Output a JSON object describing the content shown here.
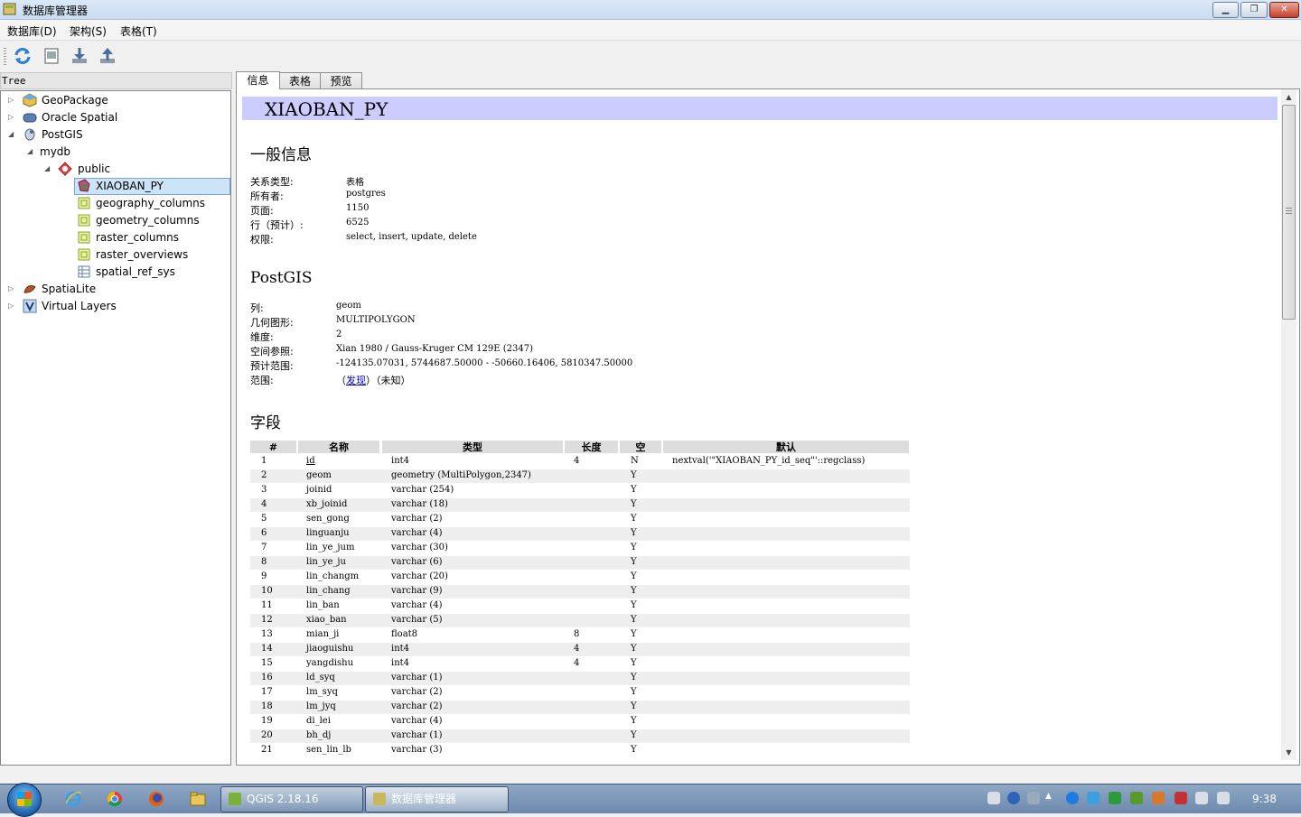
{
  "window": {
    "title": "数据库管理器"
  },
  "menu": {
    "database": "数据库(D)",
    "schema": "架构(S)",
    "table": "表格(T)"
  },
  "toolbar": {
    "buttons": [
      "refresh-icon",
      "sql-window-icon",
      "import-icon",
      "export-icon"
    ]
  },
  "tree": {
    "title": "Tree",
    "items": [
      {
        "label": "GeoPackage",
        "icon": "geopackage-icon"
      },
      {
        "label": "Oracle Spatial",
        "icon": "oracle-icon"
      },
      {
        "label": "PostGIS",
        "icon": "postgis-icon"
      },
      {
        "label": "mydb",
        "icon": ""
      },
      {
        "label": "public",
        "icon": "schema-icon"
      },
      {
        "label": "XIAOBAN_PY",
        "icon": "polygon-layer-icon"
      },
      {
        "label": "geography_columns",
        "icon": "table-icon"
      },
      {
        "label": "geometry_columns",
        "icon": "table-icon"
      },
      {
        "label": "raster_columns",
        "icon": "table-icon"
      },
      {
        "label": "raster_overviews",
        "icon": "table-icon"
      },
      {
        "label": "spatial_ref_sys",
        "icon": "table-grid-icon"
      },
      {
        "label": "SpatiaLite",
        "icon": "spatialite-icon"
      },
      {
        "label": "Virtual Layers",
        "icon": "virtual-layer-icon"
      }
    ]
  },
  "tabs": [
    "信息",
    "表格",
    "预览"
  ],
  "info": {
    "table_name": "XIAOBAN_PY",
    "general_heading": "一般信息",
    "general": [
      {
        "k": "关系类型:",
        "v": "表格"
      },
      {
        "k": "所有者:",
        "v": "postgres"
      },
      {
        "k": "页面:",
        "v": "1150"
      },
      {
        "k": "行（预计）:",
        "v": "6525"
      },
      {
        "k": "权限:",
        "v": "select, insert, update, delete"
      }
    ],
    "postgis_heading": "PostGIS",
    "postgis": [
      {
        "k": "列:",
        "v": "geom"
      },
      {
        "k": "几何图形:",
        "v": "MULTIPOLYGON"
      },
      {
        "k": "维度:",
        "v": "2"
      },
      {
        "k": "空间参照:",
        "v": "Xian 1980 / Gauss-Kruger CM 129E (2347)"
      },
      {
        "k": "预计范围:",
        "v": "-124135.07031, 5744687.50000 - -50660.16406, 5810347.50000"
      }
    ],
    "extent_label": "范围:",
    "extent_open": "（",
    "extent_link": "发现",
    "extent_close": "）（未知）",
    "fields_heading": "字段",
    "field_headers": [
      "#",
      "名称",
      "类型",
      "长度",
      "空",
      "默认"
    ],
    "fields": [
      [
        "1",
        "id",
        "int4",
        "4",
        "N",
        "nextval('\"XIAOBAN_PY_id_seq\"'::regclass)"
      ],
      [
        "2",
        "geom",
        "geometry (MultiPolygon,2347)",
        "",
        "Y",
        ""
      ],
      [
        "3",
        "joinid",
        "varchar (254)",
        "",
        "Y",
        ""
      ],
      [
        "4",
        "xb_joinid",
        "varchar (18)",
        "",
        "Y",
        ""
      ],
      [
        "5",
        "sen_gong",
        "varchar (2)",
        "",
        "Y",
        ""
      ],
      [
        "6",
        "linguanju",
        "varchar (4)",
        "",
        "Y",
        ""
      ],
      [
        "7",
        "lin_ye_jum",
        "varchar (30)",
        "",
        "Y",
        ""
      ],
      [
        "8",
        "lin_ye_ju",
        "varchar (6)",
        "",
        "Y",
        ""
      ],
      [
        "9",
        "lin_changm",
        "varchar (20)",
        "",
        "Y",
        ""
      ],
      [
        "10",
        "lin_chang",
        "varchar (9)",
        "",
        "Y",
        ""
      ],
      [
        "11",
        "lin_ban",
        "varchar (4)",
        "",
        "Y",
        ""
      ],
      [
        "12",
        "xiao_ban",
        "varchar (5)",
        "",
        "Y",
        ""
      ],
      [
        "13",
        "mian_ji",
        "float8",
        "8",
        "Y",
        ""
      ],
      [
        "14",
        "jiaoguishu",
        "int4",
        "4",
        "Y",
        ""
      ],
      [
        "15",
        "yangdishu",
        "int4",
        "4",
        "Y",
        ""
      ],
      [
        "16",
        "ld_syq",
        "varchar (1)",
        "",
        "Y",
        ""
      ],
      [
        "17",
        "lm_syq",
        "varchar (2)",
        "",
        "Y",
        ""
      ],
      [
        "18",
        "lm_jyq",
        "varchar (2)",
        "",
        "Y",
        ""
      ],
      [
        "19",
        "di_lei",
        "varchar (4)",
        "",
        "Y",
        ""
      ],
      [
        "20",
        "bh_dj",
        "varchar (1)",
        "",
        "Y",
        ""
      ],
      [
        "21",
        "sen_lin_lb",
        "varchar (3)",
        "",
        "Y",
        ""
      ]
    ]
  },
  "taskbar": {
    "qgis": "QGIS 2.18.16",
    "dbmanager": "数据库管理器",
    "clock": "9:38"
  },
  "colors": {
    "header_banner": "#ccccff",
    "selection": "#cce4f7",
    "link": "#0000cc"
  }
}
